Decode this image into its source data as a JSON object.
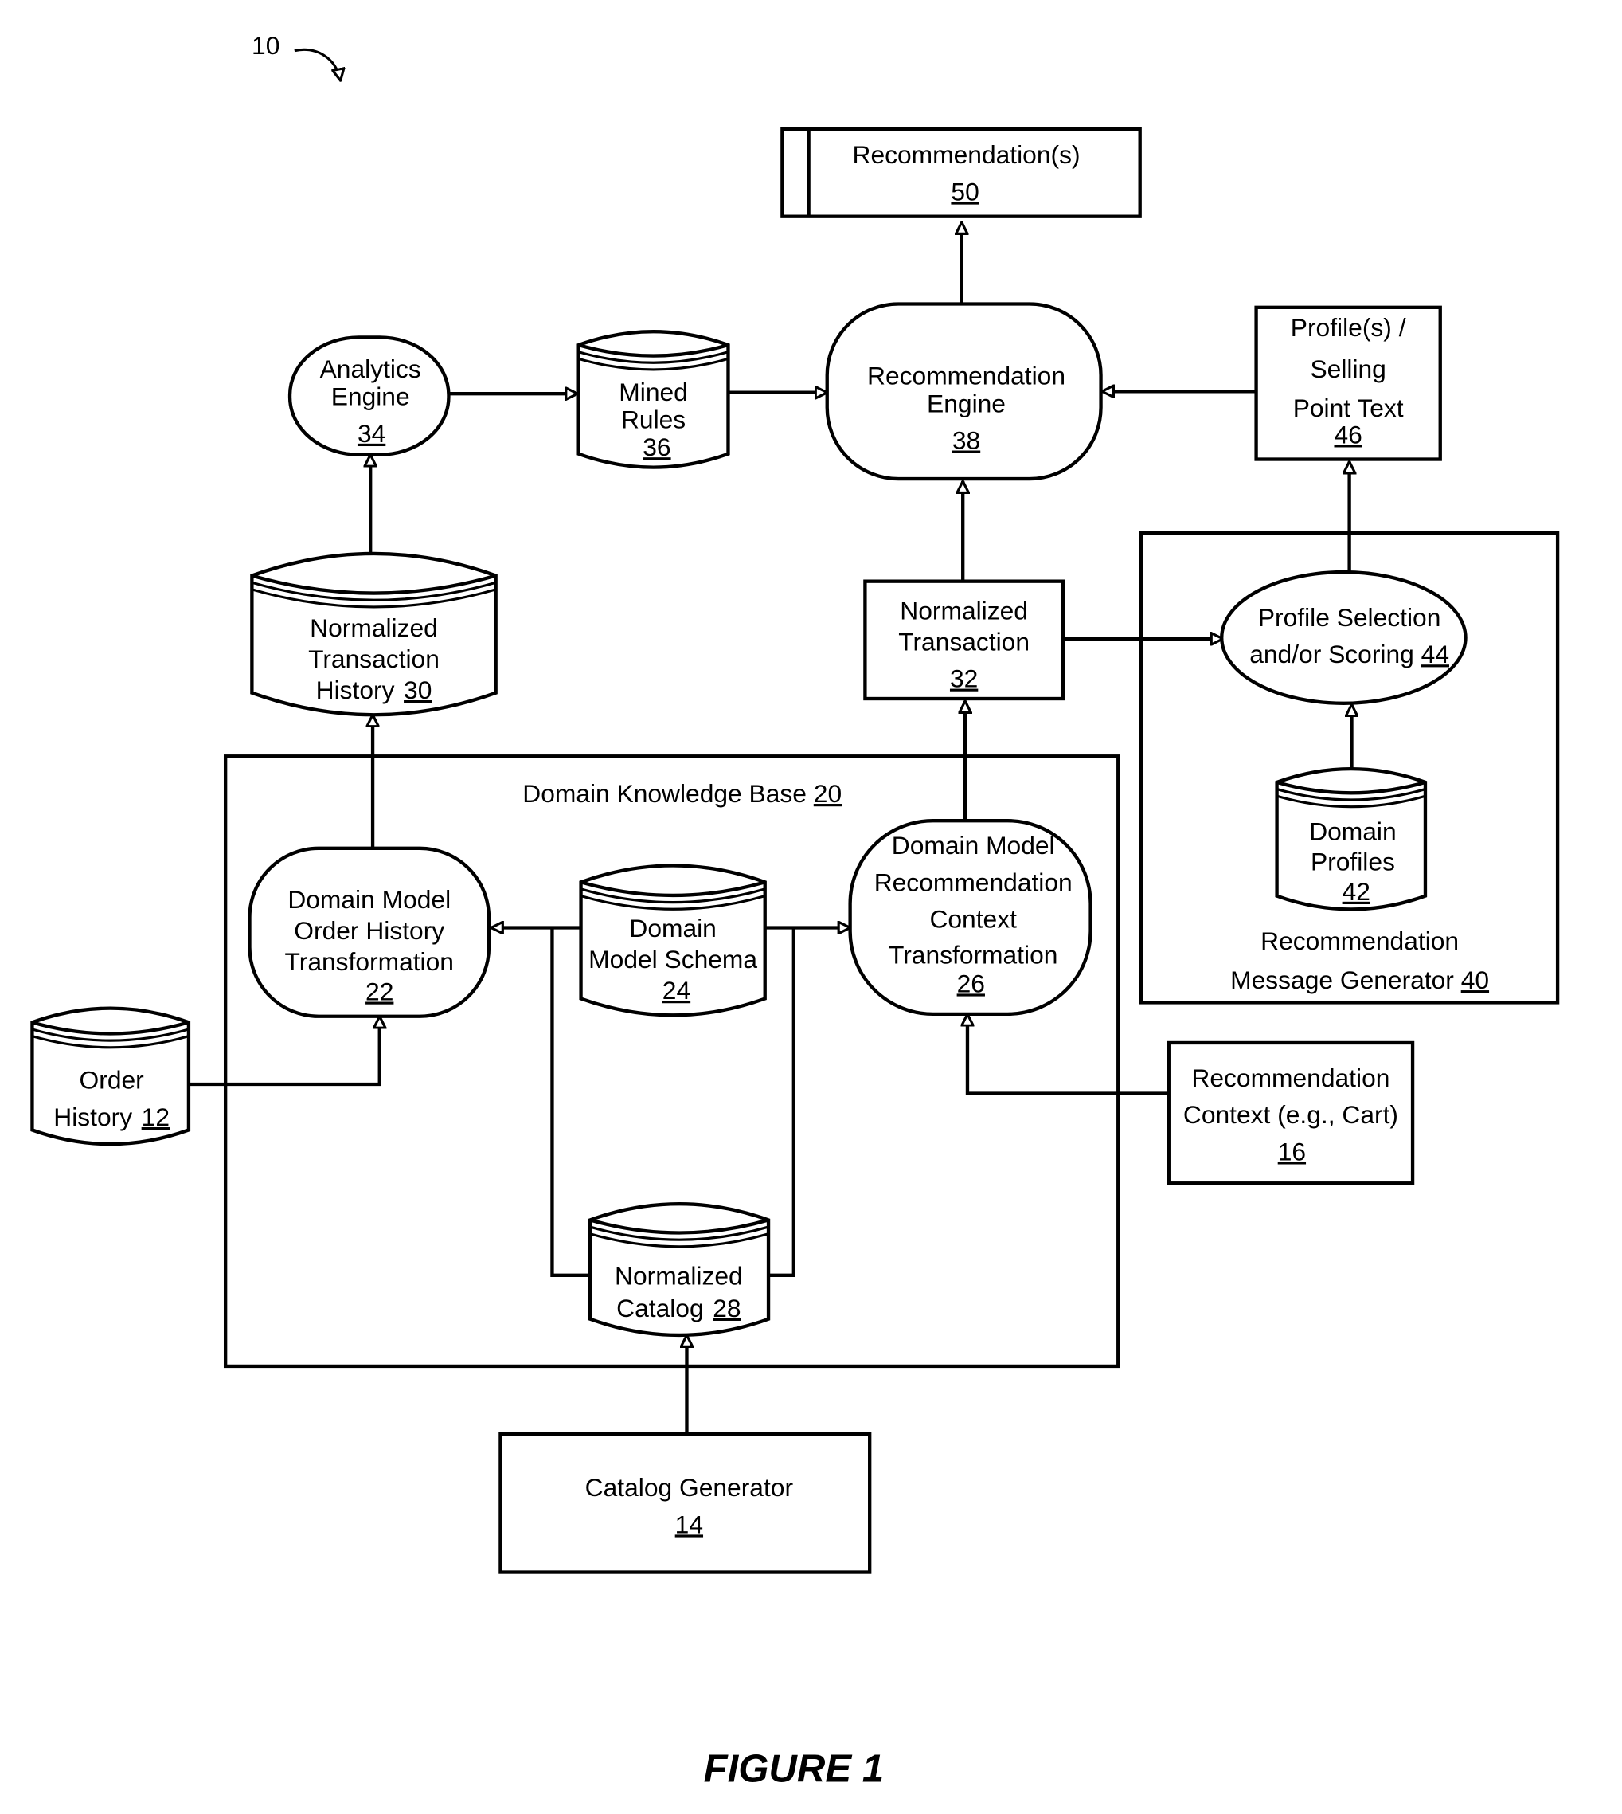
{
  "figure": {
    "caption": "FIGURE 1",
    "system_ref": "10"
  },
  "nodes": {
    "recommendations": {
      "lines": [
        "Recommendation(s)"
      ],
      "ref": "50",
      "shape": "box-with-bar"
    },
    "recommendation_engine": {
      "lines": [
        "Recommendation",
        "Engine"
      ],
      "ref": "38",
      "shape": "rounded"
    },
    "profiles_text": {
      "lines": [
        "Profile(s) /",
        "Selling",
        "Point Text"
      ],
      "ref": "46",
      "shape": "box"
    },
    "analytics_engine": {
      "lines": [
        "Analytics",
        "Engine"
      ],
      "ref": "34",
      "shape": "rounded"
    },
    "mined_rules": {
      "lines": [
        "Mined",
        "Rules"
      ],
      "ref": "36",
      "shape": "database"
    },
    "normalized_transaction_history": {
      "lines": [
        "Normalized",
        "Transaction",
        "History"
      ],
      "ref": "30",
      "shape": "database"
    },
    "normalized_transaction": {
      "lines": [
        "Normalized",
        "Transaction"
      ],
      "ref": "32",
      "shape": "box"
    },
    "profile_selection": {
      "lines": [
        "Profile Selection",
        "and/or Scoring"
      ],
      "ref": "44",
      "shape": "ellipse"
    },
    "domain_profiles": {
      "lines": [
        "Domain",
        "Profiles"
      ],
      "ref": "42",
      "shape": "database"
    },
    "recommendation_message_generator": {
      "lines": [
        "Recommendation",
        "Message Generator"
      ],
      "ref": "40",
      "shape": "container"
    },
    "domain_knowledge_base": {
      "lines": [
        "Domain Knowledge Base"
      ],
      "ref": "20",
      "shape": "container"
    },
    "order_history_transformation": {
      "lines": [
        "Domain Model",
        "Order History",
        "Transformation"
      ],
      "ref": "22",
      "shape": "rounded"
    },
    "domain_model_schema": {
      "lines": [
        "Domain",
        "Model Schema"
      ],
      "ref": "24",
      "shape": "database"
    },
    "recommendation_context_transformation": {
      "lines": [
        "Domain Model",
        "Recommendation",
        "Context",
        "Transformation"
      ],
      "ref": "26",
      "shape": "rounded"
    },
    "order_history": {
      "lines": [
        "Order",
        "History"
      ],
      "ref": "12",
      "shape": "database"
    },
    "normalized_catalog": {
      "lines": [
        "Normalized",
        "Catalog"
      ],
      "ref": "28",
      "shape": "database"
    },
    "recommendation_context": {
      "lines": [
        "Recommendation",
        "Context (e.g., Cart)"
      ],
      "ref": "16",
      "shape": "box"
    },
    "catalog_generator": {
      "lines": [
        "Catalog Generator"
      ],
      "ref": "14",
      "shape": "box"
    }
  },
  "edges": [
    {
      "from": "recommendation_engine",
      "to": "recommendations"
    },
    {
      "from": "profiles_text",
      "to": "recommendation_engine"
    },
    {
      "from": "analytics_engine",
      "to": "mined_rules"
    },
    {
      "from": "mined_rules",
      "to": "recommendation_engine"
    },
    {
      "from": "normalized_transaction_history",
      "to": "analytics_engine"
    },
    {
      "from": "normalized_transaction",
      "to": "recommendation_engine"
    },
    {
      "from": "normalized_transaction",
      "to": "profile_selection"
    },
    {
      "from": "profile_selection",
      "to": "profiles_text"
    },
    {
      "from": "domain_profiles",
      "to": "profile_selection"
    },
    {
      "from": "order_history_transformation",
      "to": "normalized_transaction_history"
    },
    {
      "from": "recommendation_context_transformation",
      "to": "normalized_transaction"
    },
    {
      "from": "domain_model_schema",
      "to": "order_history_transformation"
    },
    {
      "from": "domain_model_schema",
      "to": "recommendation_context_transformation"
    },
    {
      "from": "normalized_catalog",
      "to": "order_history_transformation"
    },
    {
      "from": "normalized_catalog",
      "to": "recommendation_context_transformation"
    },
    {
      "from": "order_history",
      "to": "order_history_transformation"
    },
    {
      "from": "recommendation_context",
      "to": "recommendation_context_transformation"
    },
    {
      "from": "catalog_generator",
      "to": "normalized_catalog"
    }
  ]
}
